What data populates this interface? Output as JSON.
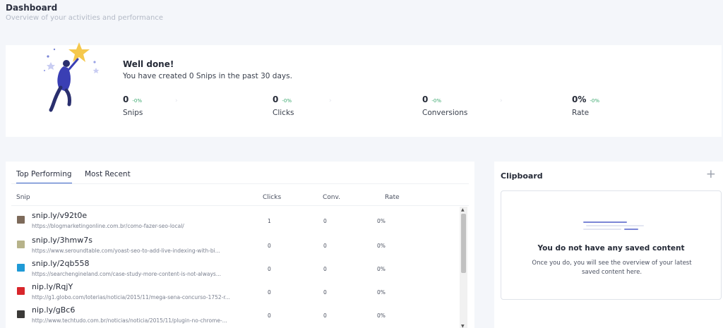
{
  "header": {
    "title": "Dashboard",
    "subtitle": "Overview of your activities and performance"
  },
  "welcome": {
    "title": "Well done!",
    "text": "You have created 0 Snips in the past 30 days.",
    "illustration_icon": "woman-reaching-star-illustration"
  },
  "metrics": [
    {
      "value": "0",
      "delta": "-0%",
      "label": "Snips"
    },
    {
      "value": "0",
      "delta": "-0%",
      "label": "Clicks"
    },
    {
      "value": "0",
      "delta": "-0%",
      "label": "Conversions"
    },
    {
      "value": "0%",
      "delta": "-0%",
      "label": "Rate"
    }
  ],
  "colors": {
    "accent": "#3a63c8",
    "positive": "#3aa76d",
    "background": "#f4f6fa"
  },
  "tabs": [
    {
      "label": "Top Performing",
      "active": true
    },
    {
      "label": "Most Recent",
      "active": false
    }
  ],
  "table": {
    "columns": [
      "Snip",
      "Clicks",
      "Conv.",
      "Rate"
    ],
    "rows": [
      {
        "snip": "snip.ly/v92t0e",
        "url": "https://blogmarketingonline.com.br/como-fazer-seo-local/",
        "clicks": "1",
        "conv": "0",
        "rate": "0%",
        "favicon_color": "#7d6a5a",
        "favicon_icon": "site-favicon"
      },
      {
        "snip": "snip.ly/3hmw7s",
        "url": "https://www.seroundtable.com/yoast-seo-to-add-live-indexing-with-bi...",
        "clicks": "0",
        "conv": "0",
        "rate": "0%",
        "favicon_color": "#b7b38a",
        "favicon_icon": "site-favicon"
      },
      {
        "snip": "snip.ly/2qb558",
        "url": "https://searchengineland.com/case-study-more-content-is-not-always...",
        "clicks": "0",
        "conv": "0",
        "rate": "0%",
        "favicon_color": "#1f9ad6",
        "favicon_icon": "sel-favicon"
      },
      {
        "snip": "nip.ly/RqjY",
        "url": "http://g1.globo.com/loterias/noticia/2015/11/mega-sena-concurso-1752-r...",
        "clicks": "0",
        "conv": "0",
        "rate": "0%",
        "favicon_color": "#d8262b",
        "favicon_icon": "g1-favicon"
      },
      {
        "snip": "nip.ly/gBc6",
        "url": "http://www.techtudo.com.br/noticias/noticia/2015/11/plugin-no-chrome-...",
        "clicks": "0",
        "conv": "0",
        "rate": "0%",
        "favicon_color": "#3b3a38",
        "favicon_icon": "site-favicon"
      }
    ]
  },
  "clipboard": {
    "title": "Clipboard",
    "add_label": "+",
    "empty_title": "You do not have any saved content",
    "empty_text": "Once you do, you will see the overview of your latest saved content here."
  }
}
